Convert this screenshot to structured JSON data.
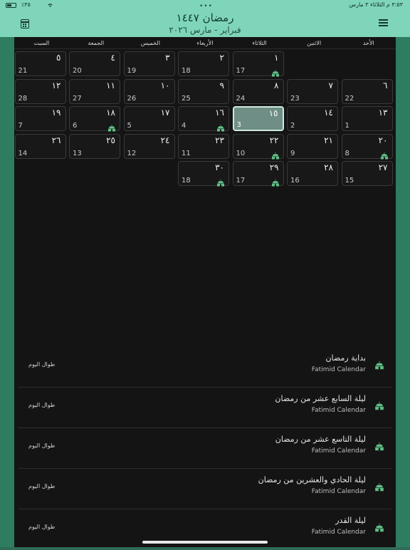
{
  "status": {
    "time": "٣:٥٣ م   الثلاثاء ٣ مارس",
    "battery": "٪٣٥"
  },
  "header": {
    "hijri_title": "رمضان ١٤٤٧",
    "gregorian_subtitle": "فبراير - مارس ٢٠٢٦"
  },
  "weekdays": [
    "الأحد",
    "الاثنين",
    "الثلاثاء",
    "الأربعاء",
    "الخميس",
    "الجمعة",
    "السبت"
  ],
  "days": [
    {
      "col": 2,
      "row": 0,
      "hijri": "١",
      "greg": "17",
      "event": true
    },
    {
      "col": 3,
      "row": 0,
      "hijri": "٢",
      "greg": "18",
      "event": false
    },
    {
      "col": 4,
      "row": 0,
      "hijri": "٣",
      "greg": "19",
      "event": false
    },
    {
      "col": 5,
      "row": 0,
      "hijri": "٤",
      "greg": "20",
      "event": false
    },
    {
      "col": 6,
      "row": 0,
      "hijri": "٥",
      "greg": "21",
      "event": false
    },
    {
      "col": 0,
      "row": 1,
      "hijri": "٦",
      "greg": "22",
      "event": false
    },
    {
      "col": 1,
      "row": 1,
      "hijri": "٧",
      "greg": "23",
      "event": false
    },
    {
      "col": 2,
      "row": 1,
      "hijri": "٨",
      "greg": "24",
      "event": false
    },
    {
      "col": 3,
      "row": 1,
      "hijri": "٩",
      "greg": "25",
      "event": false
    },
    {
      "col": 4,
      "row": 1,
      "hijri": "١٠",
      "greg": "26",
      "event": false
    },
    {
      "col": 5,
      "row": 1,
      "hijri": "١١",
      "greg": "27",
      "event": false
    },
    {
      "col": 6,
      "row": 1,
      "hijri": "١٢",
      "greg": "28",
      "event": false
    },
    {
      "col": 0,
      "row": 2,
      "hijri": "١٣",
      "greg": "1",
      "event": false
    },
    {
      "col": 1,
      "row": 2,
      "hijri": "١٤",
      "greg": "2",
      "event": false
    },
    {
      "col": 2,
      "row": 2,
      "hijri": "١٥",
      "greg": "3",
      "event": false,
      "today": true
    },
    {
      "col": 3,
      "row": 2,
      "hijri": "١٦",
      "greg": "4",
      "event": true
    },
    {
      "col": 4,
      "row": 2,
      "hijri": "١٧",
      "greg": "5",
      "event": false
    },
    {
      "col": 5,
      "row": 2,
      "hijri": "١٨",
      "greg": "6",
      "event": true
    },
    {
      "col": 6,
      "row": 2,
      "hijri": "١٩",
      "greg": "7",
      "event": false
    },
    {
      "col": 0,
      "row": 3,
      "hijri": "٢٠",
      "greg": "8",
      "event": true
    },
    {
      "col": 1,
      "row": 3,
      "hijri": "٢١",
      "greg": "9",
      "event": false
    },
    {
      "col": 2,
      "row": 3,
      "hijri": "٢٢",
      "greg": "10",
      "event": true
    },
    {
      "col": 3,
      "row": 3,
      "hijri": "٢٣",
      "greg": "11",
      "event": false
    },
    {
      "col": 4,
      "row": 3,
      "hijri": "٢٤",
      "greg": "12",
      "event": false
    },
    {
      "col": 5,
      "row": 3,
      "hijri": "٢٥",
      "greg": "13",
      "event": false
    },
    {
      "col": 6,
      "row": 3,
      "hijri": "٢٦",
      "greg": "14",
      "event": false
    },
    {
      "col": 0,
      "row": 4,
      "hijri": "٢٧",
      "greg": "15",
      "event": false
    },
    {
      "col": 1,
      "row": 4,
      "hijri": "٢٨",
      "greg": "16",
      "event": false
    },
    {
      "col": 2,
      "row": 4,
      "hijri": "٢٩",
      "greg": "17",
      "event": true
    },
    {
      "col": 3,
      "row": 4,
      "hijri": "٣٠",
      "greg": "18",
      "event": true
    }
  ],
  "events": [
    {
      "title": "بداية رمضان",
      "calendar": "Fatimid Calendar",
      "all_day": "طوال اليوم"
    },
    {
      "title": "ليلة السابع عشر من رمضان",
      "calendar": "Fatimid Calendar",
      "all_day": "طوال اليوم"
    },
    {
      "title": "ليلة التاسع عشر من رمضان",
      "calendar": "Fatimid Calendar",
      "all_day": "طوال اليوم"
    },
    {
      "title": "ليلة الحادي والعشرين من رمضان",
      "calendar": "Fatimid Calendar",
      "all_day": "طوال اليوم"
    },
    {
      "title": "ليلة القدر",
      "calendar": "Fatimid Calendar",
      "all_day": "طوال اليوم"
    }
  ],
  "colors": {
    "accent": "#7fd5b9",
    "event_icon": "#5fbf86",
    "today": "#6f8f86"
  },
  "icons": {
    "menu": "menu-icon",
    "calendar": "calendar-icon",
    "event": "mosque-icon"
  }
}
